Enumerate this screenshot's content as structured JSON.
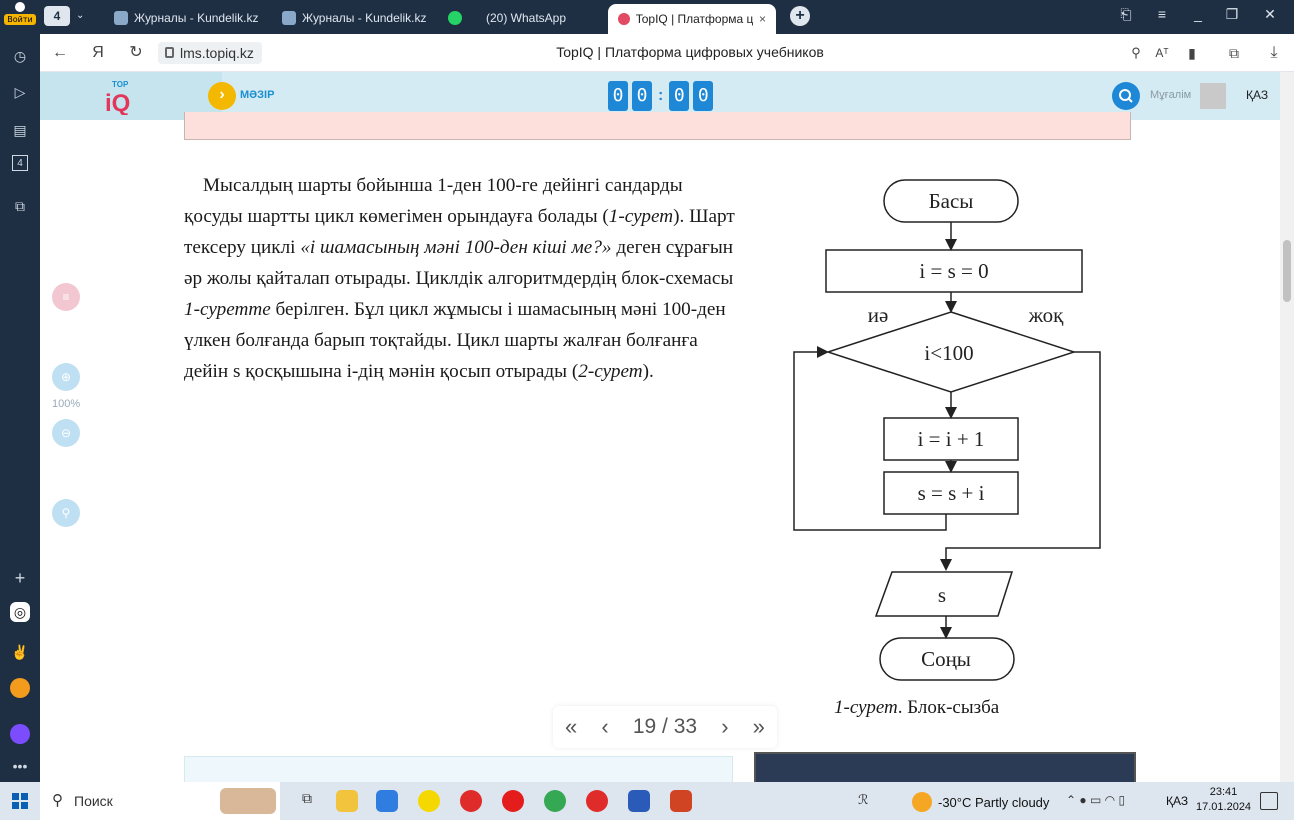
{
  "browser": {
    "login_label": "Войти",
    "tab_count": "4",
    "tabs": [
      {
        "label": "Журналы - Kundelik.kz"
      },
      {
        "label": "Журналы - Kundelik.kz"
      },
      {
        "label": "(20) WhatsApp"
      },
      {
        "label": "TopIQ | Платформа циф"
      }
    ],
    "url": "lms.topiq.kz",
    "page_title": "TopIQ | Платформа цифровых учебников"
  },
  "site": {
    "menu_label": "МӘЗІР",
    "timer_digits": [
      "0",
      "0",
      "0",
      "0"
    ],
    "timer_sep": ":",
    "role": "Мұғалім",
    "lang": "ҚАЗ",
    "zoom": "100%"
  },
  "content": {
    "p_a": "Мысалдың шарты бойынша 1-ден 100-ге дейінгі сандарды қосуды шартты цикл көмегімен орындауға болады (",
    "p_fig1": "1-сурет",
    "p_b": "). Шарт тексеру циклі ",
    "p_question": "«i шамасының мәні 100-ден кіші ме?»",
    "p_c": " деген сұрағын әр жолы қайталап отырады. Циклдік алгоритмдердің блок-схемасы ",
    "p_fig1b": "1-суретте",
    "p_d": " берілген. Бұл цикл жұмысы i шамасының мәні 100-ден үлкен болғанда барып тоқтайды. Цикл шарты жалған болғанға дейін s қосқышына i-дің мәнін қосып отырады (",
    "p_fig2": "2-сурет",
    "p_e": ").",
    "caption_italic": "1-сурет",
    "caption_rest": ". Блок-сызба"
  },
  "flowchart": {
    "start": "Басы",
    "init": "i = s = 0",
    "yes": "иә",
    "no": "жоқ",
    "cond": "i<100",
    "inc": "i = i + 1",
    "sum": "s = s + i",
    "output": "s",
    "end": "Соңы"
  },
  "pager": {
    "first": "«",
    "prev": "‹",
    "current": "19",
    "sep": "/",
    "total": "33",
    "next": "›",
    "last": "»"
  },
  "taskbar": {
    "search_label": "Поиск",
    "weather": "-30°C  Partly cloudy",
    "lang": "ҚАЗ",
    "time": "23:41",
    "date": "17.01.2024"
  },
  "colors": {
    "accent": "#1e88d6",
    "menu_button": "#f5b800",
    "header_bg": "#d4ebf3",
    "note_bar": "#fde0dc"
  }
}
